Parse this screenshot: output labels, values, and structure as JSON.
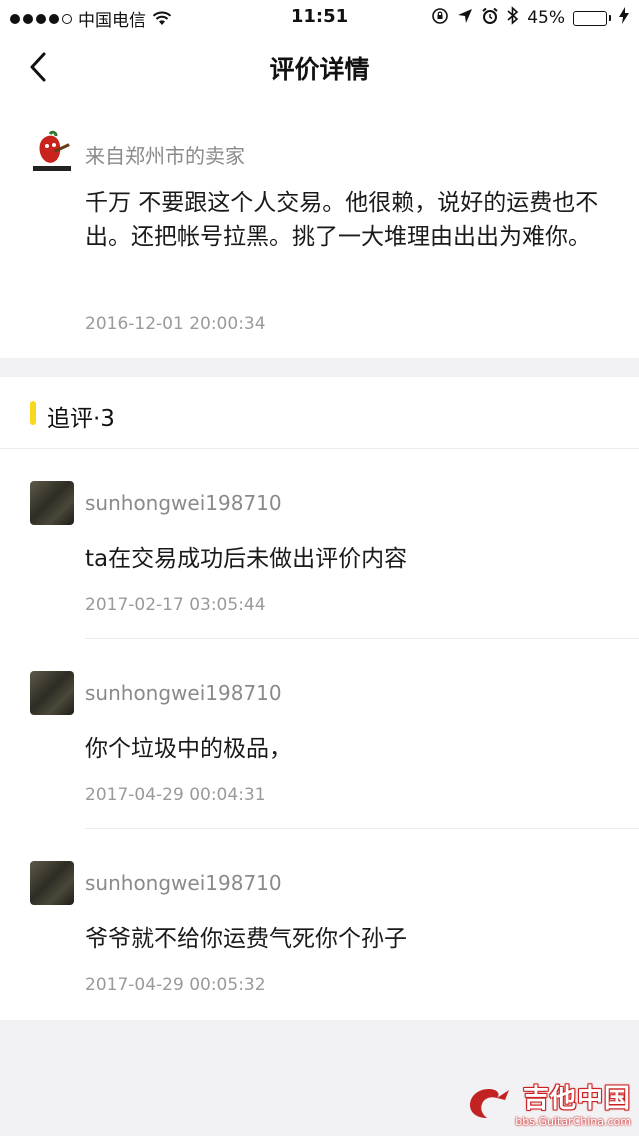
{
  "status_bar": {
    "carrier": "中国电信",
    "time": "11:51",
    "battery_text": "45%",
    "battery_level": 0.45
  },
  "nav": {
    "title": "评价详情"
  },
  "review": {
    "seller_label": "来自郑州市的卖家",
    "text": "千万 不要跟这个人交易。他很赖，说好的运费也不出。还把帐号拉黑。挑了一大堆理由出出为难你。",
    "time": "2016-12-01 20:00:34"
  },
  "followup": {
    "title": "追评·3",
    "comments": [
      {
        "user": "sunhongwei198710",
        "text": "ta在交易成功后未做出评价内容",
        "time": "2017-02-17 03:05:44"
      },
      {
        "user": "sunhongwei198710",
        "text": "你个垃圾中的极品，",
        "time": "2017-04-29 00:04:31"
      },
      {
        "user": "sunhongwei198710",
        "text": "爷爷就不给你运费气死你个孙子",
        "time": "2017-04-29 00:05:32"
      }
    ]
  },
  "watermark": {
    "title": "吉他中国",
    "url": "bbs.GuitarChina.com"
  },
  "colors": {
    "accent_bar": "#f8d81c",
    "battery_fill": "#3cc83c",
    "watermark_red": "#c22222"
  },
  "icons": {
    "back": "chevron-left-icon",
    "wifi": "wifi-icon",
    "lock_rotation": "orientation-lock-icon",
    "location": "location-arrow-icon",
    "alarm": "alarm-icon",
    "bluetooth": "bluetooth-icon",
    "charging": "charging-bolt-icon"
  }
}
